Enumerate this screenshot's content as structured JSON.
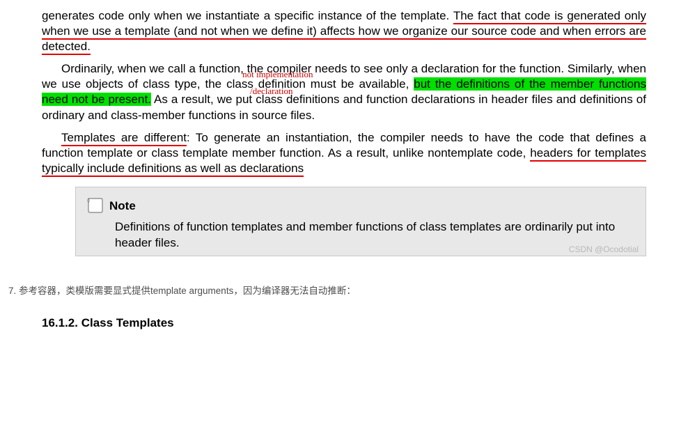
{
  "para1": {
    "pre": "generates code only when we instantiate a specific instance of the template. ",
    "u1": "The fact that code is generated only when we use a template (and not when we define it) affects how we organize our source code and when errors are detected."
  },
  "para2": {
    "a": "Ordinarily, when we call a function, the compiler needs to see only a declaration for the function. Similarly, when we use objects of class type, the ",
    "classdef": "class definition",
    "b": " must be available, ",
    "hl": "but the definitions of the member functions need not be present.",
    "c": " As a result, we put class definitions and function declarations in header files and definitions of ordinary and class-member functions in source files."
  },
  "annot": {
    "top": "not implementation",
    "bot": "/declaration"
  },
  "para3": {
    "u1": "Templates are different",
    "a": ": To generate an instantiation, the compiler needs to have the code that defines a function template or class template member function. As a result, unlike nontemplate code, ",
    "u2": "headers for templates typically include definitions as well as declarations"
  },
  "note": {
    "title": "Note",
    "body": "Definitions of function templates and member functions of class templates are ordinarily put into header files.",
    "watermark": "CSDN @Ocodotial"
  },
  "listitem": "7. 参考容器，类模版需要显式提供template arguments，因为编译器无法自动推断：",
  "heading": "16.1.2. Class Templates"
}
